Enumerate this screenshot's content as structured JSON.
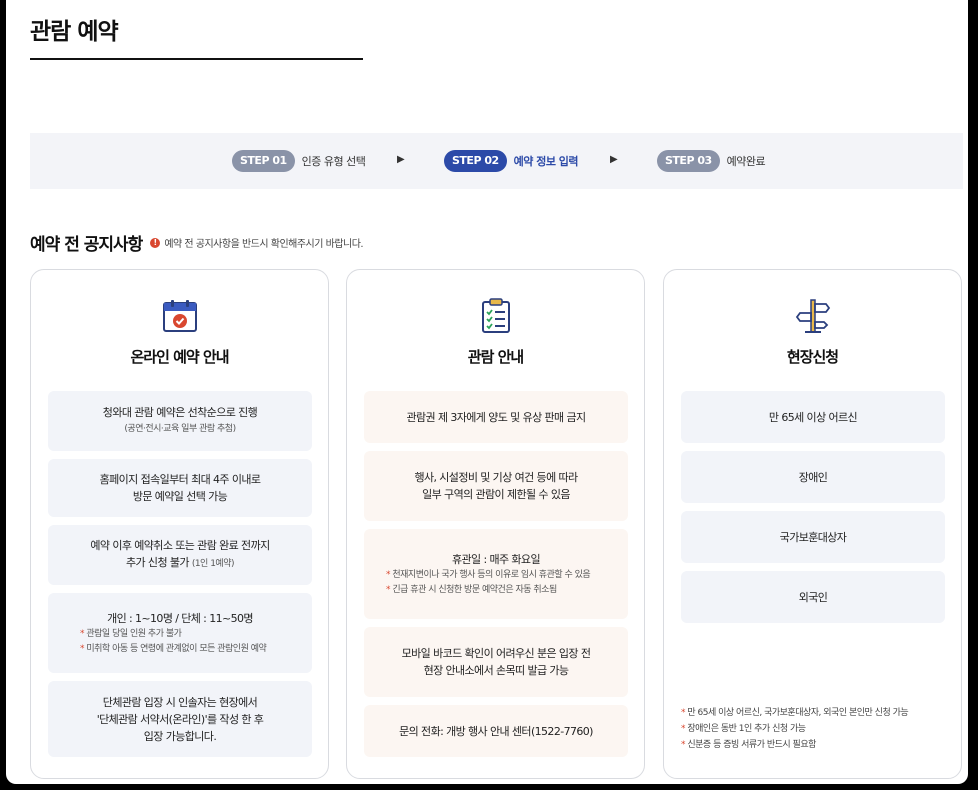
{
  "page_title": "관람 예약",
  "steps": [
    {
      "badge": "STEP 01",
      "label": "인증 유형 선택",
      "active": false
    },
    {
      "badge": "STEP 02",
      "label": "예약 정보 입력",
      "active": true
    },
    {
      "badge": "STEP 03",
      "label": "예약완료",
      "active": false
    }
  ],
  "notice": {
    "heading": "예약 전 공지사항",
    "icon_glyph": "!",
    "subtext": "예약 전 공지사항을 반드시 확인해주시기 바랍니다."
  },
  "cards": {
    "online": {
      "icon": "calendar-check-icon",
      "title": "온라인 예약 안내",
      "items": [
        {
          "line1": "청와대 관람 예약은 선착순으로 진행",
          "small": "(공연·전시·교육 일부 관람 추첨)"
        },
        {
          "line1": "홈페이지 접속일부터 최대 4주 이내로",
          "line2": "방문 예약일 선택 가능"
        },
        {
          "line1": "예약 이후 예약취소 또는 관람 완료 전까지",
          "line2": "추가 신청 불가",
          "small": "(1인 1예약)"
        },
        {
          "line1": "개인 : 1~10명 / 단체 : 11~50명",
          "notes": [
            "관람일 당일 인원 추가 불가",
            "미취학 아동 등 연령에 관계없이 모든 관람인원 예약"
          ]
        },
        {
          "line1": "단체관람 입장 시 인솔자는 현장에서",
          "line2": "'단체관람 서약서(온라인)'를 작성 한 후",
          "line3": "입장 가능합니다."
        }
      ]
    },
    "viewing": {
      "icon": "clipboard-check-icon",
      "title": "관람 안내",
      "items": [
        {
          "line1": "관람권 제 3자에게 양도 및 유상 판매 금지"
        },
        {
          "line1": "행사, 시설정비 및 기상 여건 등에 따라",
          "line2": "일부 구역의 관람이 제한될 수 있음"
        },
        {
          "line1": "휴관일 : 매주 화요일",
          "notes": [
            "천재지변이나 국가 행사 등의 이유로 임시 휴관할 수 있음",
            "긴급 휴관 시 신청한 방문 예약건은 자동 취소됨"
          ]
        },
        {
          "line1": "모바일 바코드 확인이 어려우신 분은 입장 전",
          "line2": "현장 안내소에서 손목띠 발급 가능"
        },
        {
          "line1": "문의 전화: 개방 행사 안내 센터(1522-7760)"
        }
      ]
    },
    "onsite": {
      "icon": "signpost-icon",
      "title": "현장신청",
      "items": [
        {
          "line1": "만 65세 이상 어르신"
        },
        {
          "line1": "장애인"
        },
        {
          "line1": "국가보훈대상자"
        },
        {
          "line1": "외국인"
        }
      ],
      "footnotes": [
        "만 65세 이상 어르신, 국가보훈대상자, 외국인 본인만 신청 가능",
        "장애인은 동반 1인 추가 신청 가능",
        "신분증 등 증빙 서류가 반드시 필요함"
      ]
    }
  },
  "colors": {
    "active": "#2c4aa8",
    "inactive": "#8a93a8",
    "accent": "#d9472f",
    "mustard": "#e8b84a"
  }
}
